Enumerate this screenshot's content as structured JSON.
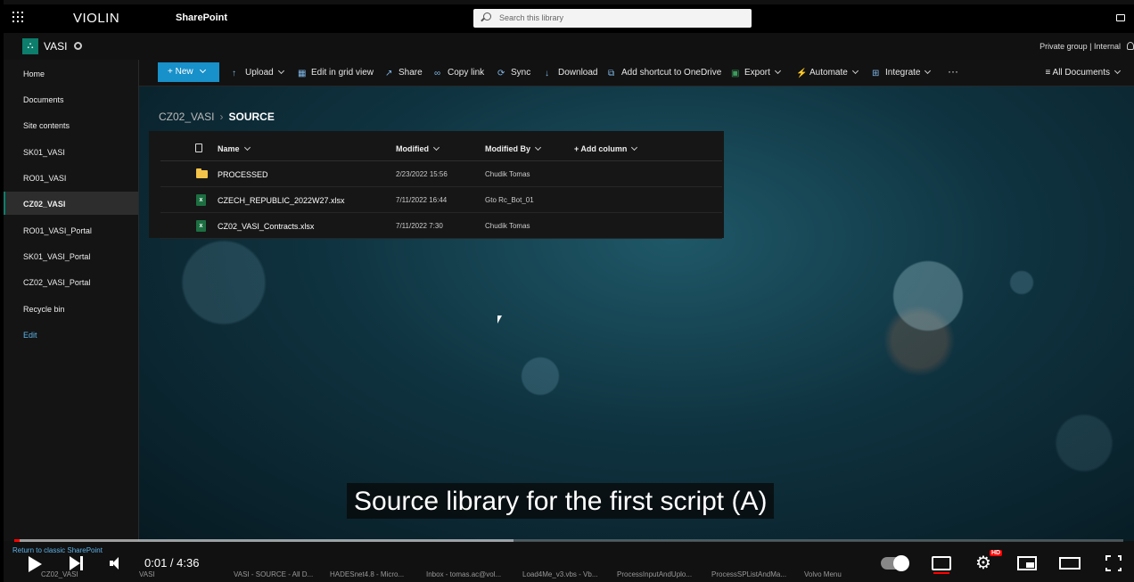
{
  "suite": {
    "brand": "VIOLIN",
    "app": "SharePoint",
    "search_placeholder": "Search this library"
  },
  "site": {
    "logo_glyph": "⛬",
    "name": "VASI",
    "privacy": "Private group | Internal"
  },
  "nav": {
    "items": [
      {
        "label": "Home"
      },
      {
        "label": "Documents"
      },
      {
        "label": "Site contents"
      },
      {
        "label": "SK01_VASI"
      },
      {
        "label": "RO01_VASI"
      },
      {
        "label": "CZ02_VASI",
        "active": true
      },
      {
        "label": "RO01_VASI_Portal"
      },
      {
        "label": "SK01_VASI_Portal"
      },
      {
        "label": "CZ02_VASI_Portal"
      },
      {
        "label": "Recycle bin"
      }
    ],
    "edit": "Edit",
    "classic_link": "Return to classic SharePoint"
  },
  "commands": {
    "new": "New",
    "upload": "Upload",
    "grid": "Edit in grid view",
    "share": "Share",
    "copy_link": "Copy link",
    "sync": "Sync",
    "download": "Download",
    "shortcut": "Add shortcut to OneDrive",
    "export": "Export",
    "automate": "Automate",
    "integrate": "Integrate",
    "more": "···",
    "view": "All Documents"
  },
  "breadcrumb": {
    "parent": "CZ02_VASI",
    "current": "SOURCE"
  },
  "columns": {
    "name": "Name",
    "modified": "Modified",
    "modified_by": "Modified By",
    "add": "+ Add column"
  },
  "files": [
    {
      "type": "folder",
      "name": "PROCESSED",
      "modified": "2/23/2022 15:56",
      "modified_by": "Chudik Tomas"
    },
    {
      "type": "xlsx",
      "name": "CZECH_REPUBLIC_2022W27.xlsx",
      "modified": "7/11/2022 16:44",
      "modified_by": "Gto Rc_Bot_01"
    },
    {
      "type": "xlsx",
      "name": "CZ02_VASI_Contracts.xlsx",
      "modified": "7/11/2022 7:30",
      "modified_by": "Chudik Tomas"
    }
  ],
  "video": {
    "subtitle": "Source library for the first script (A)",
    "time": "0:01 / 4:36",
    "quality_badge": "HD",
    "played_fraction": 0.005,
    "buffered_fraction": 0.45
  },
  "taskbar": [
    "CZ02_VASI",
    "VASI",
    "VASI - SOURCE - All D...",
    "HADESnet4.8 - Micro...",
    "Inbox - tomas.ac@vol...",
    "Load4Me_v3.vbs - Vb...",
    "ProcessInputAndUplo...",
    "ProcessSPListAndMa...",
    "Volvo Menu"
  ]
}
